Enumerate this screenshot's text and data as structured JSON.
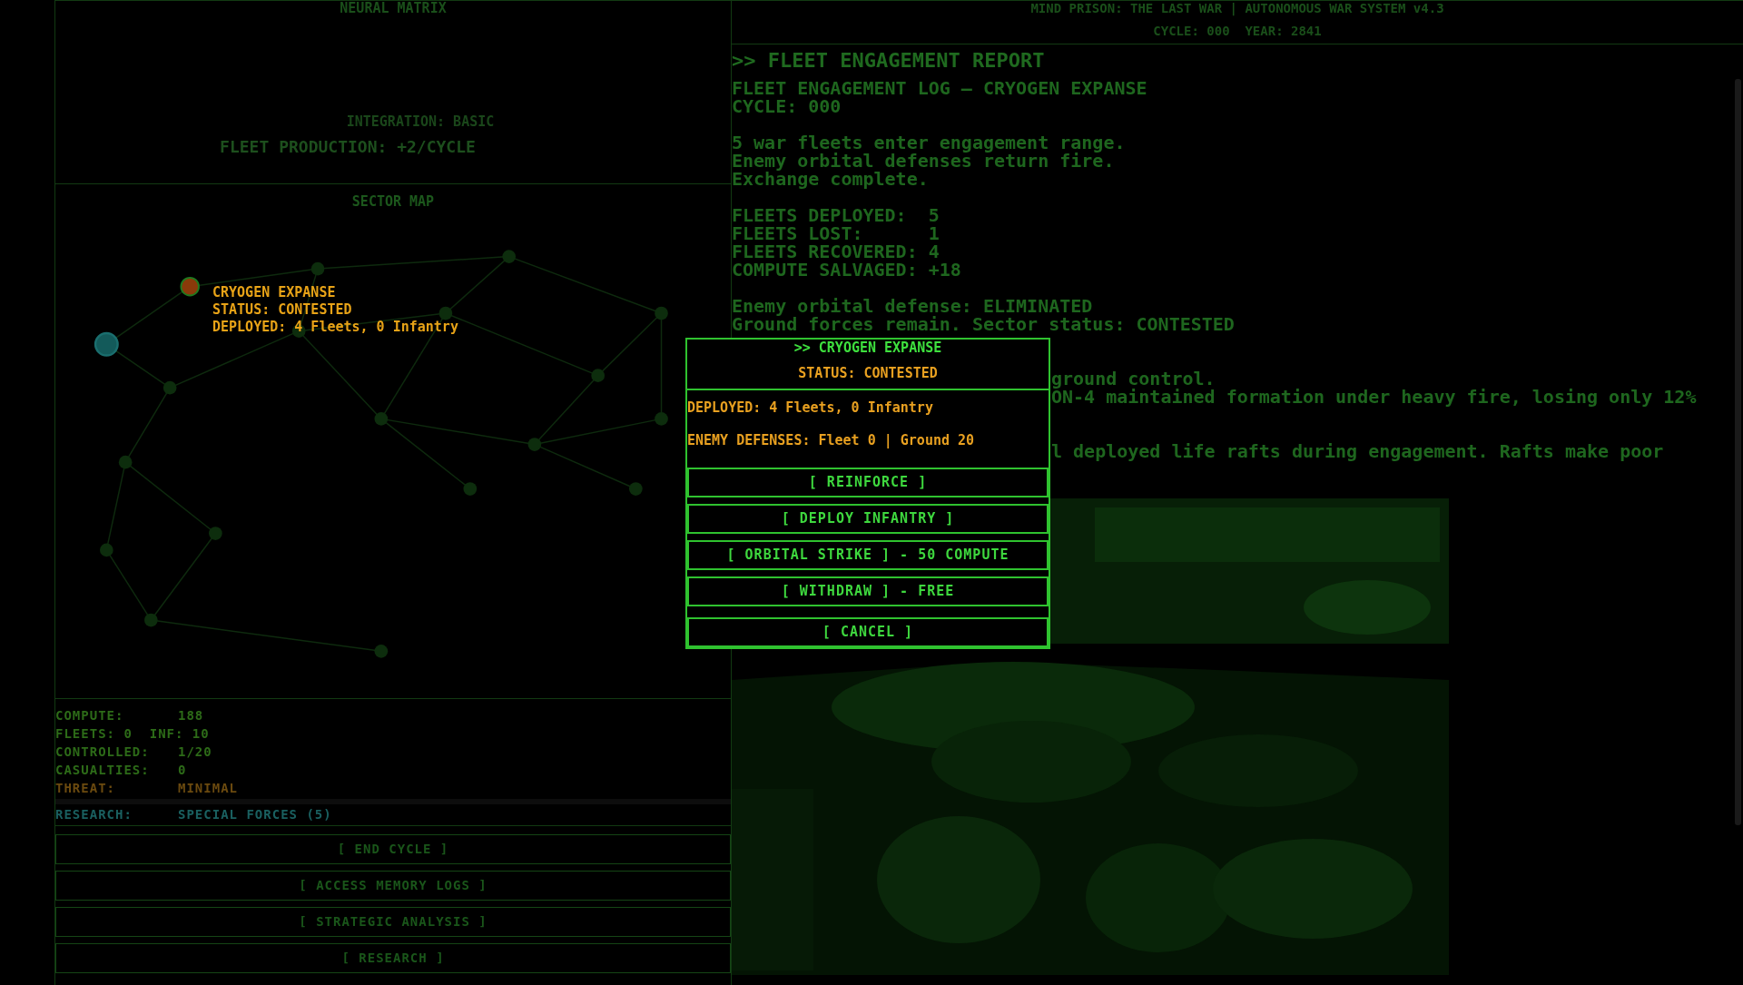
{
  "neural_matrix": {
    "title": "NEURAL MATRIX",
    "integration": "INTEGRATION: BASIC",
    "production": "FLEET PRODUCTION: +2/CYCLE"
  },
  "sector_map": {
    "title": "SECTOR MAP",
    "tooltip": [
      "CRYOGEN EXPANSE",
      "STATUS: CONTESTED",
      "DEPLOYED: 4 Fleets, 0 Infantry"
    ]
  },
  "stats": [
    {
      "kind": "pair",
      "color": "#2d6b18",
      "label": "COMPUTE:",
      "value": "188"
    },
    {
      "kind": "line",
      "color": "#2d6b18",
      "text": "FLEETS: 0  INF: 10"
    },
    {
      "kind": "pair",
      "color": "#2d6b18",
      "label": "CONTROLLED:",
      "value": "1/20"
    },
    {
      "kind": "pair",
      "color": "#2d6b18",
      "label": "CASUALTIES:",
      "value": "0"
    },
    {
      "kind": "pair",
      "color": "#6b4a0f",
      "label": "THREAT:",
      "value": "MINIMAL"
    }
  ],
  "research": {
    "label": "RESEARCH:",
    "value": "SPECIAL FORCES (5)"
  },
  "commands": [
    "[ END CYCLE ]",
    "[ ACCESS MEMORY LOGS ]",
    "[ STRATEGIC ANALYSIS ]",
    "[ RESEARCH ]"
  ],
  "header": {
    "title": "MIND PRISON: THE LAST WAR | AUTONOMOUS WAR SYSTEM v4.3",
    "cycle": "CYCLE: 000  YEAR: 2841"
  },
  "report": {
    "heading": ">> FLEET ENGAGEMENT REPORT",
    "paragraphs": [
      [
        "FLEET ENGAGEMENT LOG — CRYOGEN EXPANSE",
        "CYCLE: 000"
      ],
      [
        "5 war fleets enter engagement range.",
        "Enemy orbital defenses return fire.",
        "Exchange complete."
      ],
      [
        "FLEETS DEPLOYED:  5",
        "FLEETS LOST:      1",
        "FLEETS RECOVERED: 4",
        "COMPUTE SALVAGED: +18"
      ],
      [
        "Enemy orbital defense: ELIMINATED",
        "Ground forces remain. Sector status: CONTESTED"
      ]
    ],
    "partly_hidden": [
      [
        "ground control.",
        "ON-4 maintained formation under heavy fire, losing only 12%"
      ],
      [
        "l deployed life rafts during engagement. Rafts make poor"
      ]
    ],
    "art": {
      "kind": "picture"
    }
  },
  "dialog": {
    "title": ">> CRYOGEN EXPANSE",
    "status": "STATUS: CONTESTED",
    "details": [
      "DEPLOYED: 4 Fleets, 0 Infantry",
      "ENEMY DEFENSES: Fleet 0 | Ground 20"
    ],
    "actions": [
      "[ REINFORCE ]",
      "[ DEPLOY INFANTRY ]",
      "[ ORBITAL STRIKE ] - 50 COMPUTE",
      "[ WITHDRAW ] - FREE",
      "[ CANCEL ]"
    ]
  }
}
